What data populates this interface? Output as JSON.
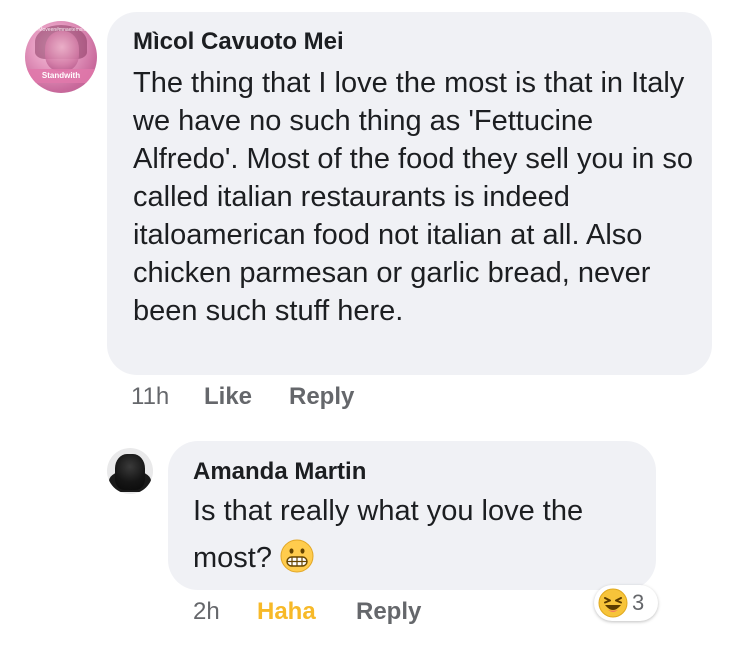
{
  "comments": [
    {
      "author": "Mìcol Cavuoto Mei",
      "avatar_banner": "Standwith",
      "avatar_top_text": "#Moveen#mnaetemsfa",
      "text": "The thing that I love the most is that in Italy we have no such thing as 'Fettucine Alfredo'. Most of the food they sell you in so called italian restaurants is indeed italoamerican food not italian at all. Also chicken parmesan or garlic bread, never been such stuff here.",
      "time": "11h",
      "like_label": "Like",
      "reply_label": "Reply"
    }
  ],
  "reply": {
    "author": "Amanda Martin",
    "text": "Is that really what you love the most?",
    "emoji": "grimacing-face",
    "time": "2h",
    "reaction_label": "Haha",
    "reply_label": "Reply",
    "reaction_count": "3",
    "reaction_emoji": "laughing-face"
  },
  "colors": {
    "bubble": "#f0f1f5",
    "text": "#1c1e21",
    "meta": "#65676b",
    "haha": "#f7b928"
  }
}
